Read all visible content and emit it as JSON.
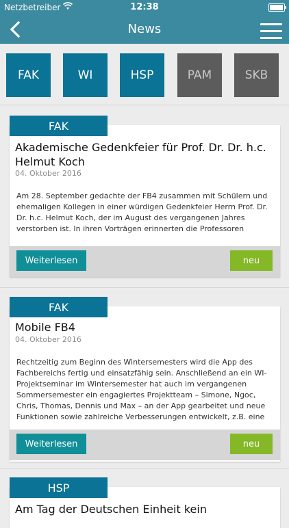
{
  "status_bar": {
    "carrier": "Netzbetreiber",
    "time": "12:38"
  },
  "nav": {
    "title": "News",
    "back_icon": "chevron-left-icon",
    "menu_icon": "hamburger-menu-icon"
  },
  "colors": {
    "nav_bg": "#3b8a9f",
    "tag_blue": "#0b7395",
    "inactive_gray": "#5c5c5c",
    "readmore_teal": "#108f98",
    "new_green": "#84b826"
  },
  "filters": [
    {
      "label": "FAK",
      "active": true
    },
    {
      "label": "WI",
      "active": true
    },
    {
      "label": "HSP",
      "active": true
    },
    {
      "label": "PAM",
      "active": false
    },
    {
      "label": "SKB",
      "active": false
    }
  ],
  "articles": [
    {
      "tag": "FAK",
      "title": "Akademische Gedenkfeier für Prof. Dr. Dr. h.c. Helmut Koch",
      "date": "04. Oktober 2016",
      "body": "Am 28. September gedachte der FB4 zusammen mit Schülern und ehemaligen Kollegen in einer würdigen Gedenkfeier Herrn Prof. Dr. Dr. h.c. Helmut Koch, der im August des vergangenen Jahres verstorben ist. In ihren Vorträgen erinnerten die Professoren Winfried Mellwig,",
      "readmore": "Weiterlesen",
      "badge": "neu"
    },
    {
      "tag": "FAK",
      "title": "Mobile FB4",
      "date": "04. Oktober 2016",
      "body": "Rechtzeitig zum Beginn des Wintersemesters wird die App des Fachbereichs fertig und einsatzfähig sein. Anschließend an ein WI-Projektseminar im Wintersemester hat auch im vergangenen Sommersemester ein engagiertes Projektteam – Simone, Ngoc, Chris, Thomas, Dennis und Max – an der App gearbeitet und neue Funktionen sowie zahlreiche Verbesserungen entwickelt, z.B. eine",
      "readmore": "Weiterlesen",
      "badge": "neu"
    },
    {
      "tag": "HSP",
      "title": "Am Tag der Deutschen Einheit kein"
    }
  ]
}
